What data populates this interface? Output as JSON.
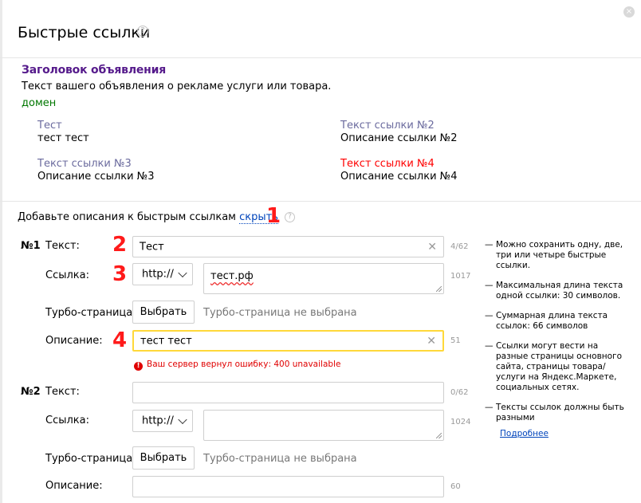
{
  "dialog": {
    "title": "Быстрые ссылки",
    "help_icon": "?",
    "close_icon": "×"
  },
  "preview": {
    "ad_title": "Заголовок объявления",
    "ad_text": "Текст вашего объявления о рекламе услуги или товара.",
    "domain": "домен",
    "links": [
      {
        "title": "Тест",
        "desc": "тест тест"
      },
      {
        "title": "Текст ссылки №2",
        "desc": "Описание ссылки №2"
      },
      {
        "title": "Текст ссылки №3",
        "desc": "Описание ссылки №3"
      },
      {
        "title": "Текст ссылки №4",
        "desc": "Описание ссылки №4",
        "title_color": "#ff0000"
      }
    ]
  },
  "form": {
    "hint": "Добавьте описания к быстрым ссылкам",
    "hint_link": "скрыть",
    "labels": {
      "text": "Текст:",
      "link": "Ссылка:",
      "turbo": "Турбо-страница:",
      "description": "Описание:"
    },
    "turbo_button": "Выбрать",
    "turbo_status": "Турбо-страница не выбрана",
    "error_message": "Ваш сервер вернул ошибку: 400 unavailable",
    "links": [
      {
        "number": "№1",
        "text_value": "Тест",
        "text_counter": "4/62",
        "protocol": "http://",
        "url_value": "тест.рф",
        "url_counter": "1017",
        "description_value": "тест тест",
        "description_counter": "51"
      },
      {
        "number": "№2",
        "text_value": "",
        "text_counter": "0/62",
        "protocol": "http://",
        "url_value": "",
        "url_counter": "1024",
        "description_value": "",
        "description_counter": "60"
      }
    ]
  },
  "tips": [
    "Можно сохранить одну, две, три или четыре быстрые ссылки.",
    "Максимальная длина текста одной ссылки: 30 символов.",
    "Суммарная длина текста ссылок: 66 символов",
    "Ссылки могут вести на разные страницы основного сайта, страницы товара/услуги на Яндекс.Маркете, социальных сетях.",
    "Тексты ссылок должны быть разными"
  ],
  "more_link": "Подробнее",
  "annotations": [
    "1",
    "2",
    "3",
    "4"
  ],
  "colors": {
    "ad_title": "#551a8b",
    "domain": "#007700",
    "link_title": "#6b6b9e",
    "error": "#e00000",
    "focus_border": "#ffd83a",
    "annotation": "#ff1a1a",
    "link": "#0044bb"
  }
}
